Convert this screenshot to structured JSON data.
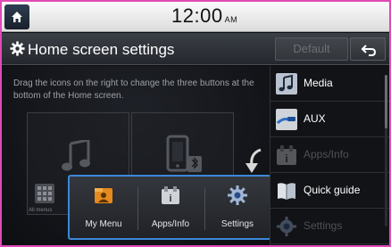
{
  "status": {
    "time": "12:00",
    "ampm": "AM"
  },
  "header": {
    "title": "Home screen settings",
    "default_label": "Default"
  },
  "instructions": "Drag the icons on the right to change the three buttons at the bottom of the Home screen.",
  "slots": {
    "all_menus_label": "All menus"
  },
  "bottom_buttons": [
    {
      "label": "My Menu",
      "icon": "my-menu-icon"
    },
    {
      "label": "Apps/Info",
      "icon": "apps-info-icon"
    },
    {
      "label": "Settings",
      "icon": "settings-icon"
    }
  ],
  "right_list": [
    {
      "label": "Media",
      "icon": "media-icon",
      "enabled": true
    },
    {
      "label": "AUX",
      "icon": "aux-icon",
      "enabled": true
    },
    {
      "label": "Apps/Info",
      "icon": "apps-info-icon",
      "enabled": false
    },
    {
      "label": "Quick guide",
      "icon": "quick-guide-icon",
      "enabled": true
    },
    {
      "label": "Settings",
      "icon": "settings-icon",
      "enabled": false
    }
  ],
  "colors": {
    "highlight": "#3b88d8",
    "frame": "#e04ab6"
  }
}
